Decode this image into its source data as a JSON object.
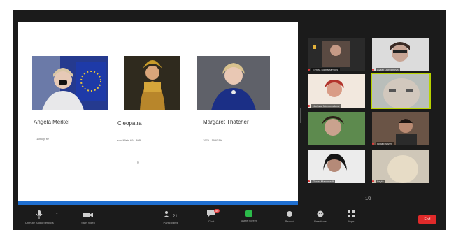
{
  "slide": {
    "cards": [
      {
        "name": "Angela Merkel",
        "note": "1985 y, fiz"
      },
      {
        "name": "Cleopatra",
        "note": "son Misir, 69 - 30B"
      },
      {
        "name": "Margaret Thatcher",
        "note": "1979 - 1990 BK"
      }
    ],
    "dot": "o"
  },
  "gallery": {
    "participants": [
      {
        "label": "Elmira Maharramova"
      },
      {
        "label": "Aysel Qurbanova"
      },
      {
        "label": "Nurlana Mammadova"
      },
      {
        "label": ""
      },
      {
        "label": ""
      },
      {
        "label": "Nihad Aliyev"
      },
      {
        "label": "Gunel Mammadli"
      },
      {
        "label": "Leyla"
      }
    ],
    "nav": "1/2"
  },
  "toolbar": {
    "items": [
      {
        "icon": "mic-icon",
        "label": "Unmute Audio Settings"
      },
      {
        "icon": "video-camera-icon",
        "label": "Start Video"
      },
      {
        "icon": "participants-icon",
        "label": "Participants",
        "count": "21"
      },
      {
        "icon": "chat-icon",
        "label": "Chat",
        "badge": "56"
      },
      {
        "icon": "share-screen-icon",
        "label": "Share Screen"
      },
      {
        "icon": "record-icon",
        "label": "Record"
      },
      {
        "icon": "reactions-icon",
        "label": "Reactions"
      },
      {
        "icon": "apps-icon",
        "label": "Apps"
      }
    ],
    "end_label": "End"
  },
  "colors": {
    "share_bar": "#1f6fd0",
    "active_speaker": "#b7d200",
    "share_green": "#2bbb4a",
    "end_red": "#e02a2a"
  }
}
